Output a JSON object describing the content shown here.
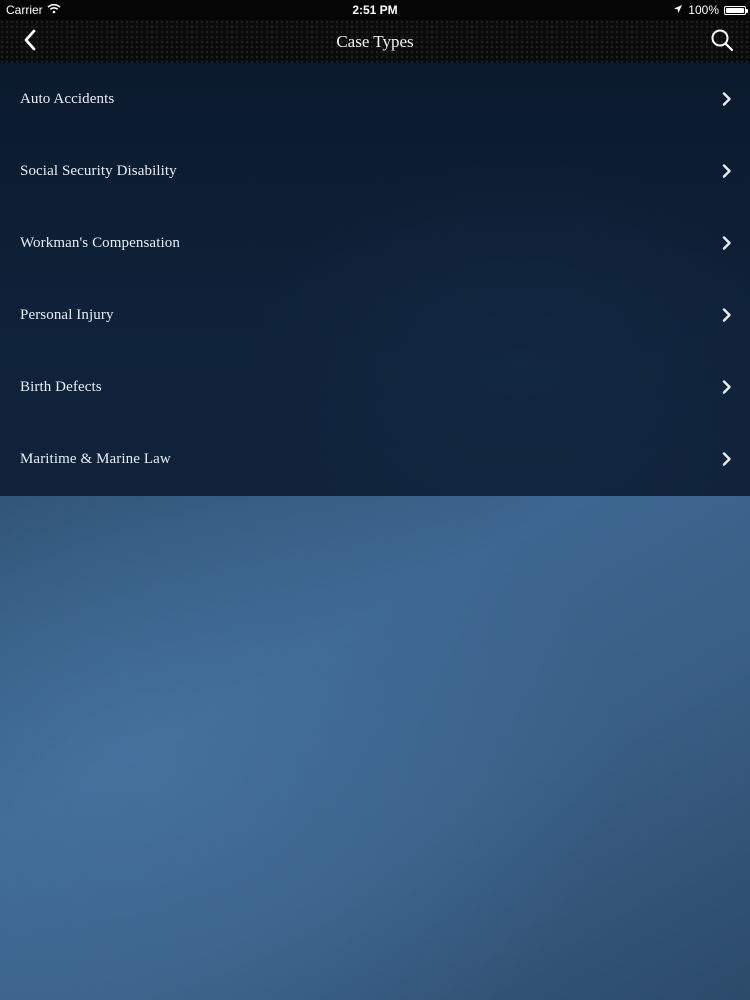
{
  "status_bar": {
    "carrier": "Carrier",
    "time": "2:51 PM",
    "battery_percent": "100%",
    "battery_level": 1.0,
    "icons": [
      "wifi-icon",
      "location-arrow-icon",
      "battery-icon"
    ]
  },
  "nav_bar": {
    "title": "Case Types",
    "back_icon": "chevron-left-icon",
    "search_icon": "search-icon"
  },
  "case_types": [
    {
      "label": "Auto Accidents"
    },
    {
      "label": "Social Security Disability"
    },
    {
      "label": "Workman's Compensation"
    },
    {
      "label": "Personal Injury"
    },
    {
      "label": "Birth Defects"
    },
    {
      "label": "Maritime & Marine Law"
    }
  ],
  "colors": {
    "nav_background": "#0b0b0c",
    "list_background": "#0d1f35",
    "page_background": "#3a5f85",
    "text": "#e9edf2"
  }
}
